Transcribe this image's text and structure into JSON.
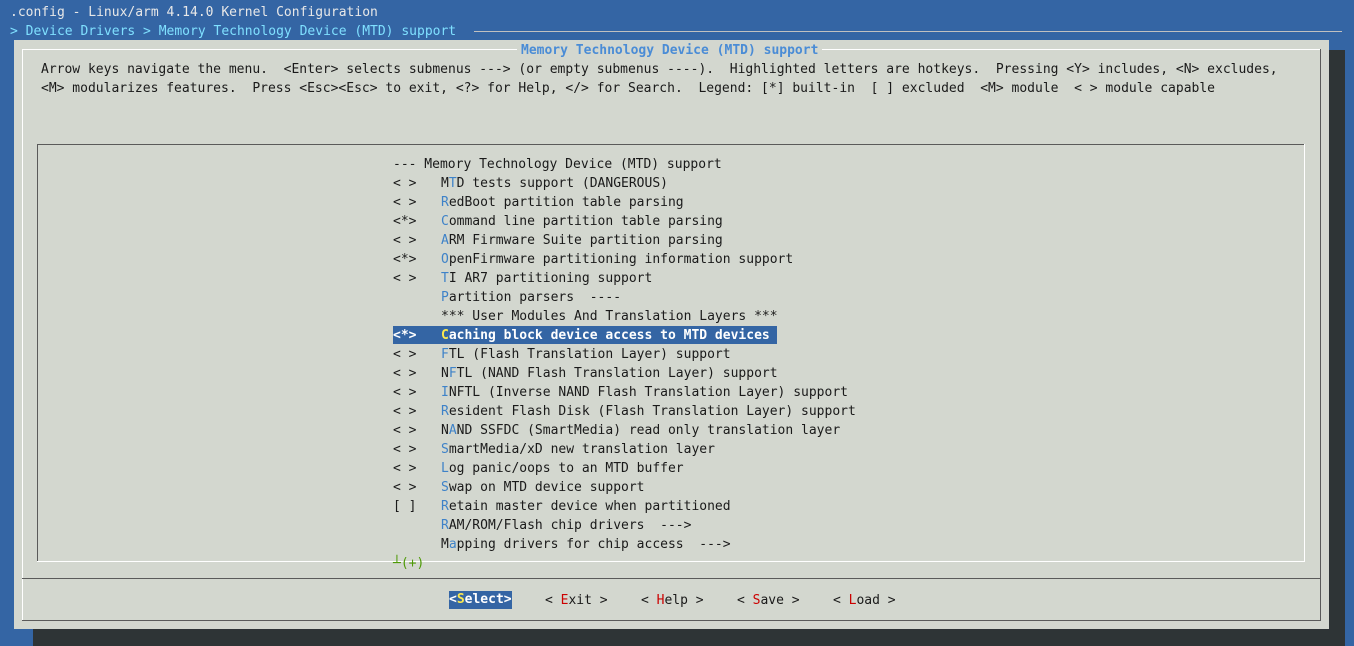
{
  "window": {
    "title": ".config - Linux/arm 4.14.0 Kernel Configuration",
    "breadcrumb": "> Device Drivers > Memory Technology Device (MTD) support"
  },
  "dialog": {
    "title": "Memory Technology Device (MTD) support",
    "help_line1": "Arrow keys navigate the menu.  <Enter> selects submenus ---> (or empty submenus ----).  Highlighted letters are hotkeys.  Pressing <Y> includes, <N> excludes,",
    "help_line2": "<M> modularizes features.  Press <Esc><Esc> to exit, <?> for Help, </> for Search.  Legend: [*] built-in  [ ] excluded  <M> module  < > module capable"
  },
  "menu": {
    "header": "--- Memory Technology Device (MTD) support",
    "items": [
      {
        "ind": "< >",
        "pre": "M",
        "hk": "T",
        "rest": "D tests support (DANGEROUS)"
      },
      {
        "ind": "< >",
        "pre": "",
        "hk": "R",
        "rest": "edBoot partition table parsing"
      },
      {
        "ind": "<*>",
        "pre": "",
        "hk": "C",
        "rest": "ommand line partition table parsing"
      },
      {
        "ind": "< >",
        "pre": "",
        "hk": "A",
        "rest": "RM Firmware Suite partition parsing"
      },
      {
        "ind": "<*>",
        "pre": "",
        "hk": "O",
        "rest": "penFirmware partitioning information support"
      },
      {
        "ind": "< >",
        "pre": "",
        "hk": "T",
        "rest": "I AR7 partitioning support"
      },
      {
        "ind": "",
        "pre": "",
        "hk": "P",
        "rest": "artition parsers  ----"
      },
      {
        "ind": "",
        "pre": "*** User Modules And Translation Layers ***",
        "hk": "",
        "rest": ""
      },
      {
        "ind": "<*>",
        "pre": "",
        "hk": "C",
        "rest": "aching block device access to MTD devices"
      },
      {
        "ind": "< >",
        "pre": "",
        "hk": "F",
        "rest": "TL (Flash Translation Layer) support"
      },
      {
        "ind": "< >",
        "pre": "N",
        "hk": "F",
        "rest": "TL (NAND Flash Translation Layer) support"
      },
      {
        "ind": "< >",
        "pre": "",
        "hk": "I",
        "rest": "NFTL (Inverse NAND Flash Translation Layer) support"
      },
      {
        "ind": "< >",
        "pre": "",
        "hk": "R",
        "rest": "esident Flash Disk (Flash Translation Layer) support"
      },
      {
        "ind": "< >",
        "pre": "N",
        "hk": "A",
        "rest": "ND SSFDC (SmartMedia) read only translation layer"
      },
      {
        "ind": "< >",
        "pre": "",
        "hk": "S",
        "rest": "martMedia/xD new translation layer"
      },
      {
        "ind": "< >",
        "pre": "",
        "hk": "L",
        "rest": "og panic/oops to an MTD buffer"
      },
      {
        "ind": "< >",
        "pre": "",
        "hk": "S",
        "rest": "wap on MTD device support"
      },
      {
        "ind": "[ ]",
        "pre": "",
        "hk": "R",
        "rest": "etain master device when partitioned"
      },
      {
        "ind": "",
        "pre": "",
        "hk": "R",
        "rest": "AM/ROM/Flash chip drivers  --->"
      },
      {
        "ind": "",
        "pre": "M",
        "hk": "a",
        "rest": "pping drivers for chip access  --->"
      }
    ],
    "more_indicator": "┴(+)",
    "selected_index": 8
  },
  "buttons": [
    {
      "pre": "<",
      "hk": "S",
      "rest": "elect>"
    },
    {
      "pre": "< ",
      "hk": "E",
      "rest": "xit >"
    },
    {
      "pre": "< ",
      "hk": "H",
      "rest": "elp >"
    },
    {
      "pre": "< ",
      "hk": "S",
      "rest": "ave >"
    },
    {
      "pre": "< ",
      "hk": "L",
      "rest": "oad >"
    }
  ],
  "colors": {
    "background": "#3465a4",
    "dialog": "#d3d7cf",
    "selection": "#3465a4",
    "hotkey": "#3e82c8",
    "button_hotkey": "#cc0000",
    "title": "#4a8cd6"
  }
}
